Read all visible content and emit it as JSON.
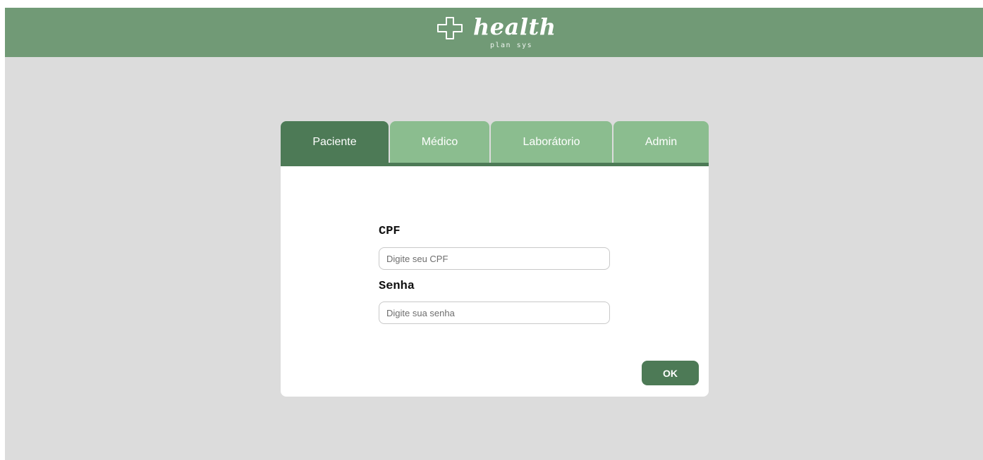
{
  "header": {
    "logo_word": "health",
    "logo_sub": "plan sys",
    "logo_icon": "medical-cross-icon"
  },
  "tabs": [
    {
      "label": "Paciente",
      "active": true
    },
    {
      "label": "Médico",
      "active": false
    },
    {
      "label": "Laborátorio",
      "active": false
    },
    {
      "label": "Admin",
      "active": false
    }
  ],
  "form": {
    "cpf_label": "CPF",
    "cpf_placeholder": "Digite seu CPF",
    "cpf_value": "",
    "senha_label": "Senha",
    "senha_placeholder": "Digite sua senha",
    "senha_value": "",
    "submit_label": "OK"
  },
  "colors": {
    "header_green": "#719a76",
    "tab_active": "#4d7a56",
    "tab_inactive": "#8bbd8f",
    "page_background": "#dcdcdc"
  }
}
